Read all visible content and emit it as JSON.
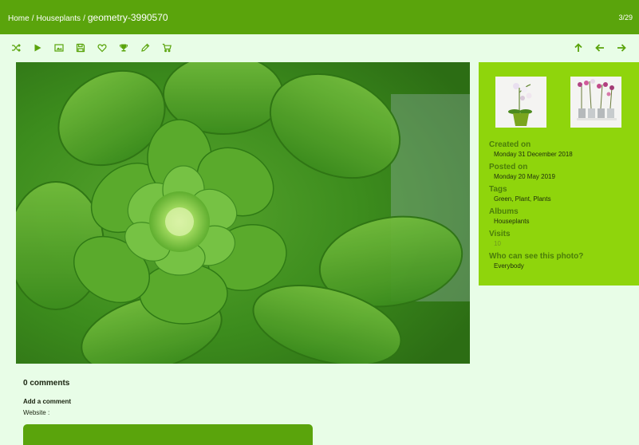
{
  "breadcrumb": {
    "home": "Home",
    "separator": "/",
    "album": "Houseplants",
    "current": "geometry-3990570"
  },
  "counter": "3/29",
  "toolbar": {
    "left_icons": [
      "shuffle-icon",
      "play-icon",
      "image-size-icon",
      "save-icon",
      "heart-icon",
      "trophy-icon",
      "pencil-icon",
      "cart-icon"
    ],
    "right_icons": [
      "arrow-up-icon",
      "arrow-left-icon",
      "arrow-right-icon"
    ],
    "icon_color": "#5aa40c"
  },
  "info": {
    "created_label": "Created on",
    "created_value": "Monday 31 December 2018",
    "posted_label": "Posted on",
    "posted_value": "Monday 20 May 2019",
    "tags_label": "Tags",
    "tags_value": "Green, Plant, Plants",
    "albums_label": "Albums",
    "albums_value": "Houseplants",
    "visits_label": "Visits",
    "visits_value": "10",
    "privacy_label": "Who can see this photo?",
    "privacy_value": "Everybody"
  },
  "comments": {
    "count_label": "0 comments",
    "add_label": "Add a comment",
    "website_label": "Website :"
  },
  "colors": {
    "header": "#5aa40c",
    "panel": "#8fd50c",
    "background": "#e8fde7",
    "label": "#4b7d0a"
  }
}
